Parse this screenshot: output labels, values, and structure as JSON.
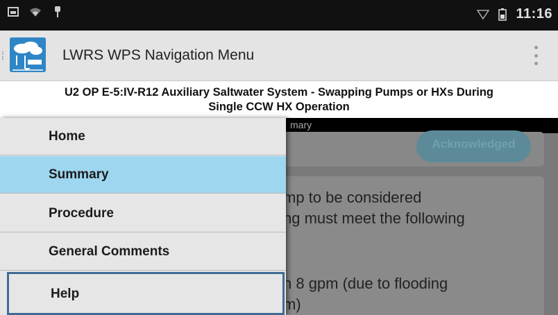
{
  "status_bar": {
    "time": "11:16",
    "left_icons": [
      "image-icon",
      "wifi-icon",
      "usb-icon"
    ],
    "right_icons": [
      "signal-icon",
      "battery-icon"
    ]
  },
  "app_bar": {
    "title": "LWRS WPS Navigation Menu"
  },
  "procedure": {
    "title_line1": "U2 OP E-5:IV-R12 Auxiliary Saltwater System - Swapping Pumps or HXs During",
    "title_line2": "Single CCW HX Operation"
  },
  "background": {
    "header_text": "mary",
    "acknowledge_label": "Acknowledged",
    "lines": [
      "mp to be considered",
      "ng must meet the following",
      "n 8 gpm (due to flooding",
      "m)"
    ]
  },
  "nav": {
    "items": [
      {
        "label": "Home",
        "selected": false
      },
      {
        "label": "Summary",
        "selected": true
      },
      {
        "label": "Procedure",
        "selected": false
      },
      {
        "label": "General Comments",
        "selected": false
      },
      {
        "label": "Help",
        "selected": false
      }
    ]
  },
  "colors": {
    "status_bar": "#111111",
    "app_bar": "#e4e4e4",
    "selected_nav": "#9ed6ef",
    "help_border": "#3f6b97",
    "logo": "#2f86c6"
  }
}
